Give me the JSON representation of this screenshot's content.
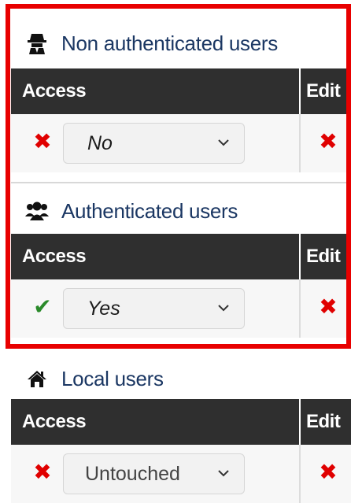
{
  "sections": [
    {
      "title": "Non authenticated users",
      "icon": "spy-icon",
      "columns": {
        "access": "Access",
        "edit": "Edit"
      },
      "access_status": "no",
      "access_value": "No",
      "edit_status": "no"
    },
    {
      "title": "Authenticated users",
      "icon": "users-icon",
      "columns": {
        "access": "Access",
        "edit": "Edit"
      },
      "access_status": "yes",
      "access_value": "Yes",
      "edit_status": "no"
    },
    {
      "title": "Local users",
      "icon": "home-icon",
      "columns": {
        "access": "Access",
        "edit": "Edit"
      },
      "access_status": "no",
      "access_value": "Untouched",
      "edit_status": "no"
    }
  ],
  "colors": {
    "highlight": "#e80000",
    "title": "#1b3763",
    "header_bar": "#2f2f2f",
    "status_no": "#e00000",
    "status_yes": "#2a8a2a"
  }
}
